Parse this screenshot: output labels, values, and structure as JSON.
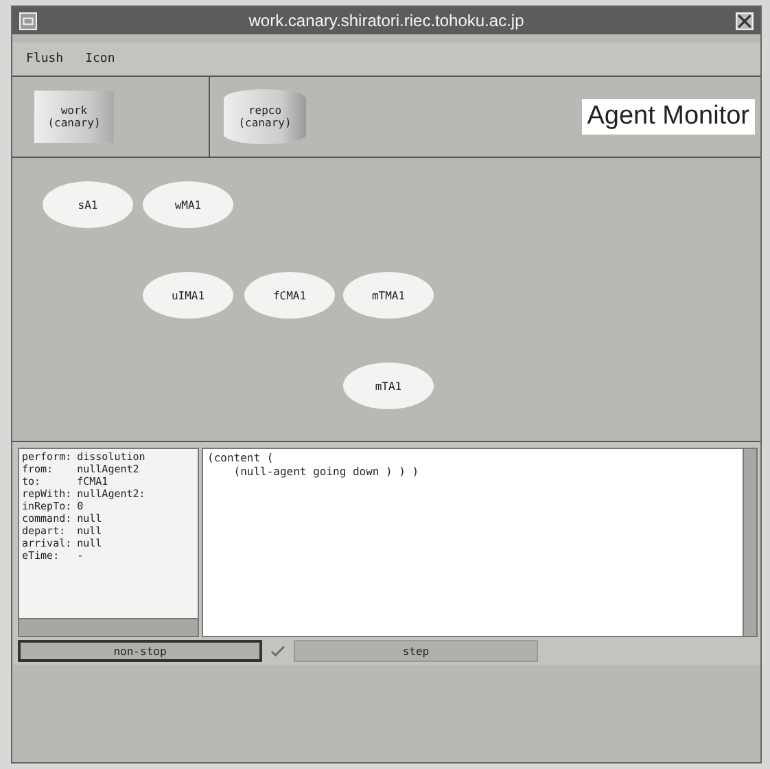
{
  "window": {
    "title": "work.canary.shiratori.riec.tohoku.ac.jp"
  },
  "menu": [
    "Flush",
    "Icon"
  ],
  "hosts": [
    {
      "kind": "box",
      "name": "work",
      "domain": "(canary)"
    },
    {
      "kind": "cylinder",
      "name": "repco",
      "domain": "(canary)"
    }
  ],
  "monitor_label": "Agent Monitor",
  "agents": [
    {
      "name": "sA1"
    },
    {
      "name": "wMA1"
    },
    {
      "name": "uIMA1"
    },
    {
      "name": "fCMA1"
    },
    {
      "name": "mTMA1"
    },
    {
      "name": "mTA1"
    }
  ],
  "message_fields": [
    {
      "key": "perform:",
      "value": "dissolution"
    },
    {
      "key": "from:",
      "value": "nullAgent2"
    },
    {
      "key": "to:",
      "value": "fCMA1"
    },
    {
      "key": "repWith:",
      "value": "nullAgent2:"
    },
    {
      "key": "inRepTo:",
      "value": "0"
    },
    {
      "key": "command:",
      "value": "null"
    },
    {
      "key": "depart:",
      "value": "null"
    },
    {
      "key": "arrival:",
      "value": "null"
    },
    {
      "key": "eTime:",
      "value": "-"
    }
  ],
  "content_lines": [
    "(content (",
    "    (null-agent going down ) ) )"
  ],
  "buttons": [
    {
      "label": "non-stop",
      "selected": true
    },
    {
      "label": "step",
      "selected": false
    }
  ]
}
